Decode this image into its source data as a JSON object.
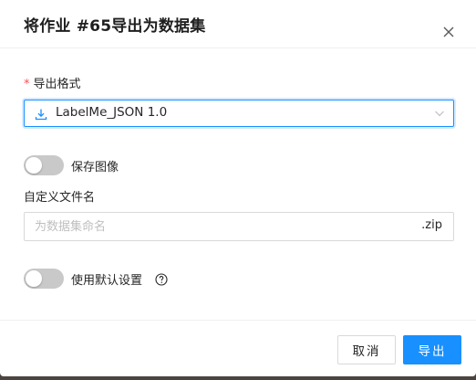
{
  "dialog": {
    "title": "将作业 #65导出为数据集"
  },
  "form": {
    "export_format": {
      "required_mark": "*",
      "label": "导出格式",
      "selected": "LabelMe_JSON 1.0",
      "icon": "download-icon"
    },
    "save_images": {
      "label": "保存图像",
      "enabled": false
    },
    "custom_name": {
      "label": "自定义文件名",
      "placeholder": "为数据集命名",
      "value": "",
      "suffix": ".zip"
    },
    "use_default_settings": {
      "label": "使用默认设置",
      "enabled": false,
      "help_icon": "question-circle-icon"
    }
  },
  "footer": {
    "cancel_label": "取消",
    "export_label": "导出"
  },
  "colors": {
    "primary": "#1890ff",
    "required": "#ff4d4f",
    "switch_off": "#c9c9c9"
  }
}
